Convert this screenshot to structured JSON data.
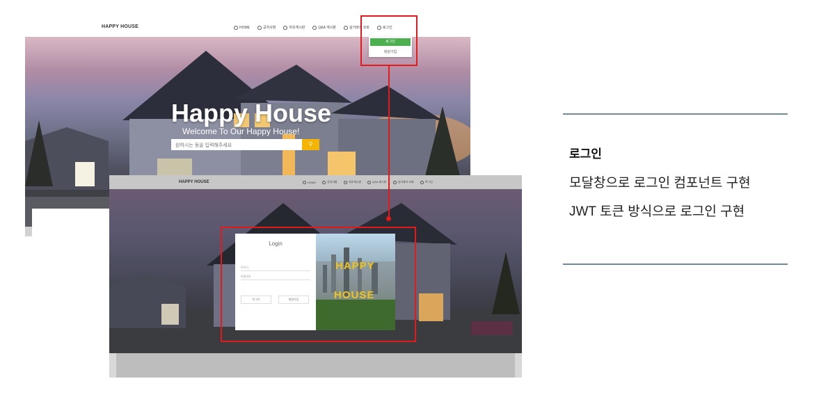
{
  "shot1": {
    "brand": "HAPPY HOUSE",
    "menu": [
      "HOME",
      "공지사항",
      "자유게시판",
      "Q&A 게시판",
      "실거래가 조회",
      "로그인"
    ],
    "hero_title": "Happy House",
    "hero_subtitle": "Welcome To Our Happy House!",
    "search_placeholder": "원하시는 동을 입력해주세요",
    "search_icon": "search-icon",
    "dropdown": {
      "login": "로그인",
      "signup": "회원가입"
    }
  },
  "shot2": {
    "brand": "HAPPY HOUSE",
    "menu": [
      "HOME",
      "공지사항",
      "자유게시판",
      "Q&A 게시판",
      "실거래가 조회",
      "로그인"
    ],
    "modal": {
      "title": "Login",
      "id_placeholder": "아이디",
      "pw_placeholder": "비밀번호",
      "login_button": "로그인",
      "signup_button": "회원가입",
      "image_text_1": "HAPPY",
      "image_text_2": "HOUSE"
    }
  },
  "description": {
    "title": "로그인",
    "lines": [
      "모달창으로 로그인 컴포넌트 구현",
      "JWT 토큰 방식으로 로그인 구현"
    ]
  },
  "colors": {
    "highlight": "#e3191b",
    "accent_green": "#4caf50",
    "rule": "#6f8996",
    "search_button": "#f4b400"
  }
}
